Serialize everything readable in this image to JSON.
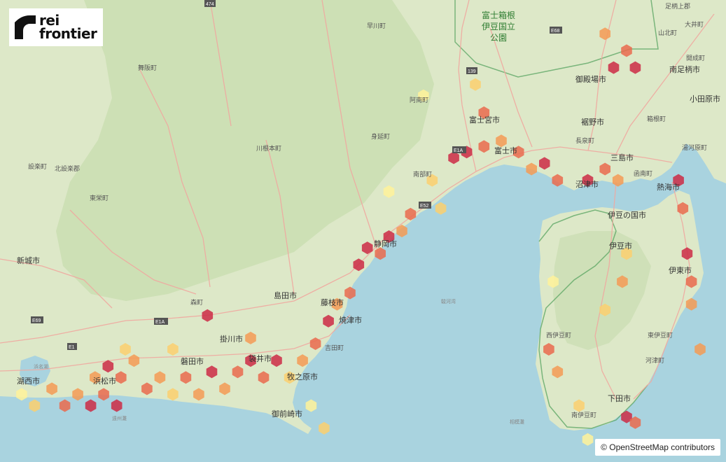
{
  "brand": {
    "line1": "rei",
    "line2": "frontier"
  },
  "attribution": "© OpenStreetMap contributors",
  "colors": {
    "water": "#a9d3df",
    "land": "#dde8c8",
    "forest": "#c9ddb0",
    "road": "#f0a8a0",
    "hex_scale": [
      "#fff29a",
      "#fbcf6e",
      "#f59a55",
      "#ea6a4d",
      "#cc2a45"
    ]
  },
  "park_label": [
    "富士箱根",
    "伊豆国立",
    "公園"
  ],
  "places": [
    {
      "name": "舞阪町"
    },
    {
      "name": "早川町"
    },
    {
      "name": "富士宮市"
    },
    {
      "name": "富士市"
    },
    {
      "name": "御殿場市"
    },
    {
      "name": "裾野市"
    },
    {
      "name": "長泉町"
    },
    {
      "name": "三島市"
    },
    {
      "name": "函南町"
    },
    {
      "name": "熱海市"
    },
    {
      "name": "沼津市"
    },
    {
      "name": "伊豆の国市"
    },
    {
      "name": "伊豆市"
    },
    {
      "name": "伊東市"
    },
    {
      "name": "西伊豆町"
    },
    {
      "name": "東伊豆町"
    },
    {
      "name": "河津町"
    },
    {
      "name": "下田市"
    },
    {
      "name": "南伊豆町"
    },
    {
      "name": "静岡市"
    },
    {
      "name": "島田市"
    },
    {
      "name": "藤枝市"
    },
    {
      "name": "焼津市"
    },
    {
      "name": "吉田町"
    },
    {
      "name": "牧之原市"
    },
    {
      "name": "御前崎市"
    },
    {
      "name": "掛川市"
    },
    {
      "name": "袋井市"
    },
    {
      "name": "磐田市"
    },
    {
      "name": "浜松市"
    },
    {
      "name": "湖西市"
    },
    {
      "name": "新城市"
    },
    {
      "name": "森町"
    },
    {
      "name": "川根本町"
    },
    {
      "name": "設楽町"
    },
    {
      "name": "北設楽郡"
    },
    {
      "name": "東栄町"
    },
    {
      "name": "阿南町"
    },
    {
      "name": "南足柄市"
    },
    {
      "name": "小田原市"
    },
    {
      "name": "山北町"
    },
    {
      "name": "足柄上郡"
    },
    {
      "name": "開成町"
    },
    {
      "name": "大井町"
    },
    {
      "name": "箱根町"
    },
    {
      "name": "湯河原町"
    },
    {
      "name": "身延町"
    },
    {
      "name": "南部町"
    },
    {
      "name": "浜名湖"
    },
    {
      "name": "駿河湾"
    },
    {
      "name": "相模灘"
    },
    {
      "name": "遠州灘"
    }
  ],
  "roads": [
    "E69",
    "E1",
    "E1A",
    "E52",
    "E68",
    "139",
    "474",
    "E1A"
  ],
  "hexagons": [
    {
      "lon": 137.55,
      "lat": 34.72,
      "v": 1
    },
    {
      "lon": 137.58,
      "lat": 34.7,
      "v": 2
    },
    {
      "lon": 137.62,
      "lat": 34.73,
      "v": 3
    },
    {
      "lon": 137.65,
      "lat": 34.7,
      "v": 4
    },
    {
      "lon": 137.68,
      "lat": 34.72,
      "v": 3
    },
    {
      "lon": 137.71,
      "lat": 34.7,
      "v": 5
    },
    {
      "lon": 137.74,
      "lat": 34.72,
      "v": 4
    },
    {
      "lon": 137.77,
      "lat": 34.7,
      "v": 5
    },
    {
      "lon": 137.72,
      "lat": 34.75,
      "v": 3
    },
    {
      "lon": 137.75,
      "lat": 34.77,
      "v": 5
    },
    {
      "lon": 137.78,
      "lat": 34.75,
      "v": 4
    },
    {
      "lon": 137.81,
      "lat": 34.78,
      "v": 3
    },
    {
      "lon": 137.79,
      "lat": 34.8,
      "v": 2
    },
    {
      "lon": 137.84,
      "lat": 34.73,
      "v": 4
    },
    {
      "lon": 137.87,
      "lat": 34.75,
      "v": 3
    },
    {
      "lon": 137.9,
      "lat": 34.72,
      "v": 2
    },
    {
      "lon": 137.93,
      "lat": 34.75,
      "v": 4
    },
    {
      "lon": 137.96,
      "lat": 34.72,
      "v": 3
    },
    {
      "lon": 137.99,
      "lat": 34.76,
      "v": 5
    },
    {
      "lon": 138.02,
      "lat": 34.73,
      "v": 3
    },
    {
      "lon": 138.05,
      "lat": 34.76,
      "v": 4
    },
    {
      "lon": 138.08,
      "lat": 34.78,
      "v": 5
    },
    {
      "lon": 138.11,
      "lat": 34.75,
      "v": 4
    },
    {
      "lon": 138.14,
      "lat": 34.78,
      "v": 5
    },
    {
      "lon": 138.17,
      "lat": 34.75,
      "v": 2
    },
    {
      "lon": 138.2,
      "lat": 34.78,
      "v": 3
    },
    {
      "lon": 138.23,
      "lat": 34.81,
      "v": 4
    },
    {
      "lon": 138.26,
      "lat": 34.85,
      "v": 5
    },
    {
      "lon": 138.28,
      "lat": 34.88,
      "v": 3
    },
    {
      "lon": 138.31,
      "lat": 34.9,
      "v": 4
    },
    {
      "lon": 138.33,
      "lat": 34.95,
      "v": 5
    },
    {
      "lon": 138.35,
      "lat": 34.98,
      "v": 5
    },
    {
      "lon": 138.38,
      "lat": 34.97,
      "v": 4
    },
    {
      "lon": 138.4,
      "lat": 35.0,
      "v": 5
    },
    {
      "lon": 138.43,
      "lat": 35.01,
      "v": 3
    },
    {
      "lon": 138.45,
      "lat": 35.04,
      "v": 4
    },
    {
      "lon": 138.5,
      "lat": 35.1,
      "v": 2
    },
    {
      "lon": 138.55,
      "lat": 35.14,
      "v": 5
    },
    {
      "lon": 138.58,
      "lat": 35.15,
      "v": 5
    },
    {
      "lon": 138.62,
      "lat": 35.16,
      "v": 4
    },
    {
      "lon": 138.66,
      "lat": 35.17,
      "v": 3
    },
    {
      "lon": 138.7,
      "lat": 35.15,
      "v": 4
    },
    {
      "lon": 138.73,
      "lat": 35.12,
      "v": 3
    },
    {
      "lon": 138.76,
      "lat": 35.13,
      "v": 5
    },
    {
      "lon": 138.79,
      "lat": 35.1,
      "v": 4
    },
    {
      "lon": 138.86,
      "lat": 35.1,
      "v": 5
    },
    {
      "lon": 138.9,
      "lat": 35.12,
      "v": 4
    },
    {
      "lon": 138.93,
      "lat": 35.1,
      "v": 3
    },
    {
      "lon": 138.62,
      "lat": 35.22,
      "v": 4
    },
    {
      "lon": 138.6,
      "lat": 35.27,
      "v": 2
    },
    {
      "lon": 138.92,
      "lat": 35.3,
      "v": 5
    },
    {
      "lon": 138.95,
      "lat": 35.33,
      "v": 4
    },
    {
      "lon": 138.97,
      "lat": 35.3,
      "v": 5
    },
    {
      "lon": 138.9,
      "lat": 35.36,
      "v": 3
    },
    {
      "lon": 139.07,
      "lat": 35.1,
      "v": 5
    },
    {
      "lon": 139.08,
      "lat": 35.05,
      "v": 4
    },
    {
      "lon": 139.09,
      "lat": 34.97,
      "v": 5
    },
    {
      "lon": 139.1,
      "lat": 34.92,
      "v": 4
    },
    {
      "lon": 139.1,
      "lat": 34.88,
      "v": 3
    },
    {
      "lon": 138.95,
      "lat": 34.97,
      "v": 2
    },
    {
      "lon": 138.94,
      "lat": 34.92,
      "v": 3
    },
    {
      "lon": 138.9,
      "lat": 34.87,
      "v": 2
    },
    {
      "lon": 138.78,
      "lat": 34.92,
      "v": 1
    },
    {
      "lon": 138.77,
      "lat": 34.8,
      "v": 4
    },
    {
      "lon": 138.79,
      "lat": 34.76,
      "v": 3
    },
    {
      "lon": 138.95,
      "lat": 34.68,
      "v": 5
    },
    {
      "lon": 138.97,
      "lat": 34.67,
      "v": 4
    },
    {
      "lon": 138.86,
      "lat": 34.64,
      "v": 1
    },
    {
      "lon": 138.84,
      "lat": 34.7,
      "v": 2
    },
    {
      "lon": 137.98,
      "lat": 34.86,
      "v": 5
    },
    {
      "lon": 138.08,
      "lat": 34.82,
      "v": 3
    },
    {
      "lon": 137.9,
      "lat": 34.8,
      "v": 2
    },
    {
      "lon": 138.22,
      "lat": 34.7,
      "v": 1
    },
    {
      "lon": 138.25,
      "lat": 34.66,
      "v": 2
    },
    {
      "lon": 138.4,
      "lat": 35.08,
      "v": 1
    },
    {
      "lon": 138.48,
      "lat": 35.25,
      "v": 1
    },
    {
      "lon": 138.52,
      "lat": 35.05,
      "v": 2
    },
    {
      "lon": 139.12,
      "lat": 34.8,
      "v": 3
    }
  ]
}
